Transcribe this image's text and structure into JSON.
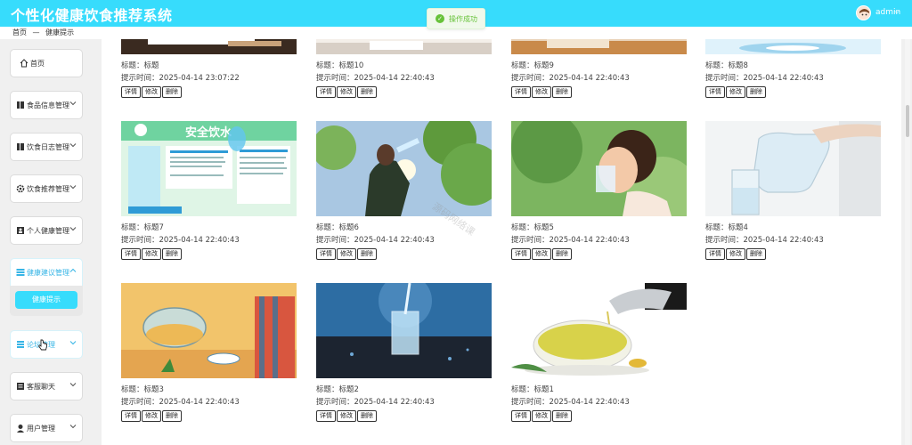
{
  "header": {
    "app_title": "个性化健康饮食推荐系统",
    "user_name": "admin",
    "user_caret": "⌵"
  },
  "toast": {
    "text": "操作成功",
    "icon": "check-icon"
  },
  "breadcrumb": {
    "home": "首页",
    "separator": "—",
    "current": "健康提示"
  },
  "sidebar": {
    "items": [
      {
        "label": "首页",
        "icon": "home-icon"
      },
      {
        "label": "食品信息管理",
        "icon": "grid-icon"
      },
      {
        "label": "饮食日志管理",
        "icon": "grid-icon"
      },
      {
        "label": "饮食推荐管理",
        "icon": "gear-icon"
      },
      {
        "label": "个人健康管理",
        "icon": "person-icon"
      },
      {
        "label": "健康建议管理",
        "icon": "list-icon"
      },
      {
        "label": "论坛管理",
        "icon": "grid-icon"
      },
      {
        "label": "客服聊天",
        "icon": "grid-icon"
      },
      {
        "label": "用户管理",
        "icon": "user-icon"
      }
    ],
    "active_submenu": "健康提示"
  },
  "cards": [
    {
      "title": "标题：标题",
      "time": "提示时间：2025-04-14 23:07:22"
    },
    {
      "title": "标题：标题10",
      "time": "提示时间：2025-04-14 22:40:43"
    },
    {
      "title": "标题：标题9",
      "time": "提示时间：2025-04-14 22:40:43"
    },
    {
      "title": "标题：标题8",
      "time": "提示时间：2025-04-14 22:40:43"
    },
    {
      "title": "标题：标题7",
      "time": "提示时间：2025-04-14 22:40:43",
      "poster_title": "安全饮水"
    },
    {
      "title": "标题：标题6",
      "time": "提示时间：2025-04-14 22:40:43"
    },
    {
      "title": "标题：标题5",
      "time": "提示时间：2025-04-14 22:40:43"
    },
    {
      "title": "标题：标题4",
      "time": "提示时间：2025-04-14 22:40:43"
    },
    {
      "title": "标题：标题3",
      "time": "提示时间：2025-04-14 22:40:43"
    },
    {
      "title": "标题：标题2",
      "time": "提示时间：2025-04-14 22:40:43"
    },
    {
      "title": "标题：标题1",
      "time": "提示时间：2025-04-14 22:40:43"
    }
  ],
  "actions": {
    "detail": "详情",
    "edit": "修改",
    "delete": "删除"
  },
  "watermark": "源码网络课"
}
